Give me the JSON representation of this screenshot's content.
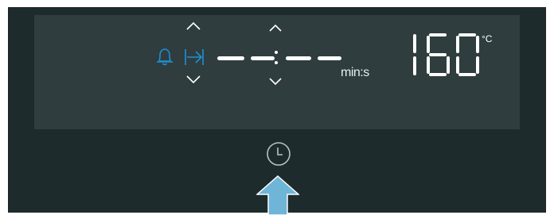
{
  "panel": {
    "timer_unit": "min:s",
    "temperature": "160",
    "temperature_unit": "°C"
  },
  "icons": {
    "alarm": "bell-icon",
    "duration": "arrow-to-bar-icon",
    "clock": "clock-icon",
    "pointer": "up-arrow-pointer-icon"
  },
  "colors": {
    "housing": "#1d2b2c",
    "display": "#2f3d3e",
    "active_icon": "#1f8fd6",
    "segment": "#ffffff",
    "pointer": "#6fb5d8",
    "clock_outline": "#b8c2c2"
  }
}
